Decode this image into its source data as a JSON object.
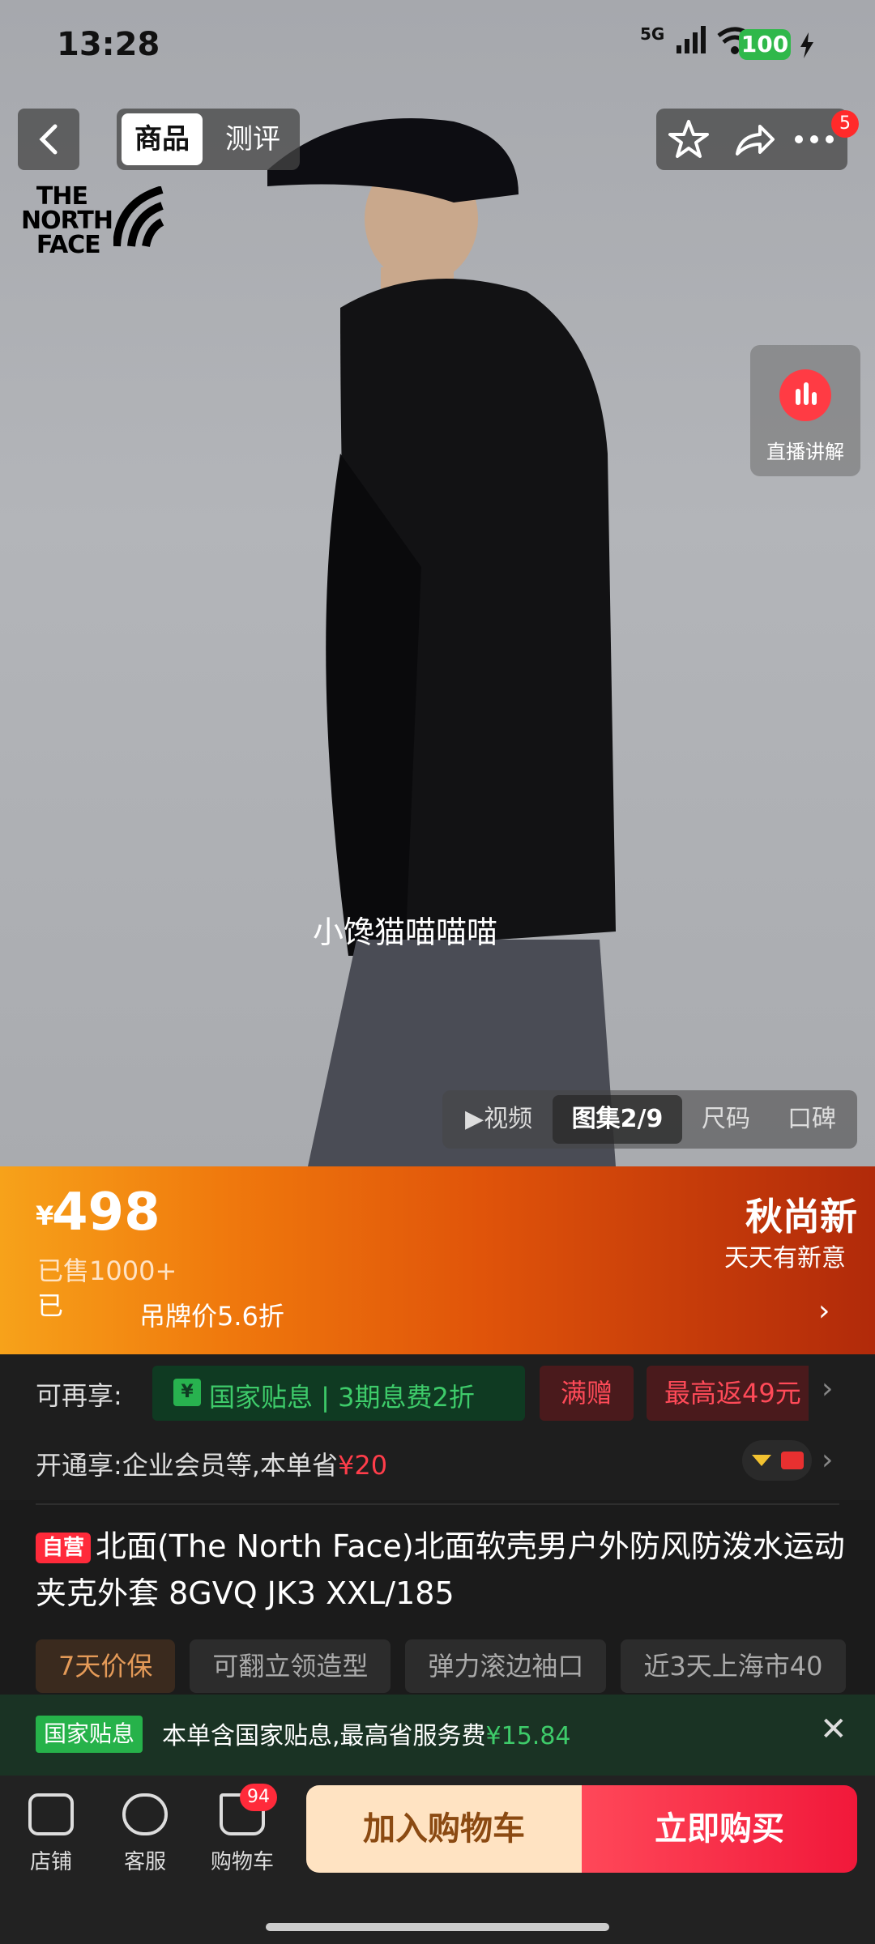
{
  "status_bar": {
    "time": "13:28",
    "signal": "5G",
    "battery": "100"
  },
  "top_nav": {
    "tabs": [
      {
        "label": "商品"
      },
      {
        "label": "测评"
      }
    ],
    "more_badge": "5"
  },
  "hero": {
    "brand_logo": "THE NORTH FACE",
    "live": {
      "label": "直播讲解"
    },
    "watermark": "小馋猫喵喵喵",
    "media_tabs": [
      {
        "label": "视频"
      },
      {
        "label": "图集2/9"
      },
      {
        "label": "尺码"
      },
      {
        "label": "口碑"
      }
    ]
  },
  "price": {
    "currency": "¥",
    "value": "498",
    "sold": "已售1000+",
    "enjoyed_label": "已享受",
    "discount": "吊牌价5.6折",
    "promo_title": "秋尚新",
    "promo_sub": "天天有新意"
  },
  "offers": {
    "label": "可再享:",
    "subsidy": "国家贴息 | 3期息费2折",
    "gift": "满赠",
    "rebate": "最高返49元"
  },
  "membership": {
    "text": "开通享:企业会员等,本单省",
    "save": "¥20"
  },
  "product": {
    "self_badge": "自营",
    "title": "北面(The North Face)北面软壳男户外防风防泼水运动夹克外套  8GVQ JK3 XXL/185"
  },
  "tags": [
    "7天价保",
    "可翻立领造型",
    "弹力滚边袖口",
    "近3天上海市40"
  ],
  "notice": {
    "badge": "国家贴息",
    "text": "本单含国家贴息,最高省服务费",
    "amount": "¥15.84"
  },
  "bottom_bar": {
    "store": "店铺",
    "service": "客服",
    "cart": "购物车",
    "cart_count": "94",
    "add_to_cart": "加入购物车",
    "buy_now": "立即购买"
  },
  "colors": {
    "accent_red": "#ff2a3a",
    "price_orange": "#f07a0d",
    "subsidy_green": "#3ecb6a"
  }
}
